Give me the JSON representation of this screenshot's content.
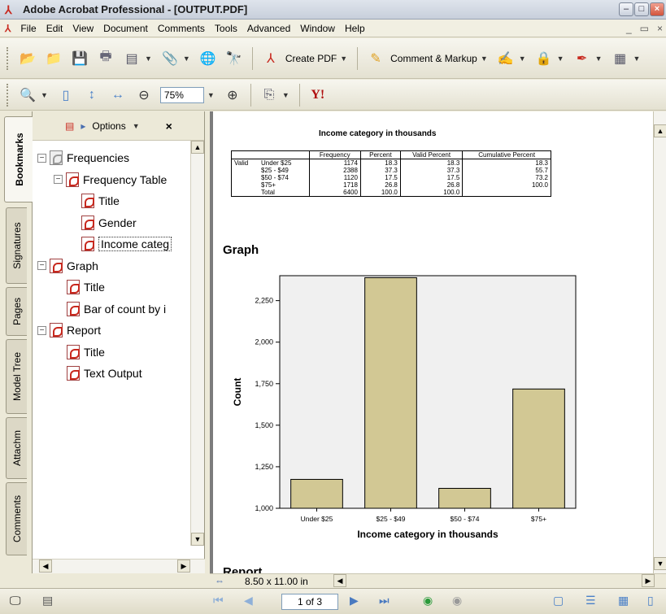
{
  "window": {
    "title": "Adobe Acrobat Professional - [OUTPUT.PDF]"
  },
  "menu": [
    "File",
    "Edit",
    "View",
    "Document",
    "Comments",
    "Tools",
    "Advanced",
    "Window",
    "Help"
  ],
  "toolbar": {
    "create_pdf": "Create PDF",
    "comment_markup": "Comment & Markup",
    "zoom": "75%"
  },
  "left_tabs": [
    "Bookmarks",
    "Signatures",
    "Pages",
    "Model Tree",
    "Attachm",
    "Comments"
  ],
  "bookmarks": {
    "options_label": "Options",
    "close": "×",
    "tree": [
      {
        "label": "Frequencies",
        "level": 0,
        "expand": "−",
        "folder": true
      },
      {
        "label": "Frequency Table",
        "level": 1,
        "expand": "−"
      },
      {
        "label": "Title",
        "level": 2
      },
      {
        "label": "Gender",
        "level": 2
      },
      {
        "label": "Income categ",
        "level": 2,
        "selected": true
      },
      {
        "label": "Graph",
        "level": 0,
        "expand": "−"
      },
      {
        "label": "Title",
        "level": 1
      },
      {
        "label": "Bar of count by i",
        "level": 1
      },
      {
        "label": "Report",
        "level": 0,
        "expand": "−"
      },
      {
        "label": "Title",
        "level": 1
      },
      {
        "label": "Text Output",
        "level": 1
      }
    ]
  },
  "document": {
    "table_title": "Income category in thousands",
    "table": {
      "headers": [
        "Frequency",
        "Percent",
        "Valid Percent",
        "Cumulative Percent"
      ],
      "group_label": "Valid",
      "rows": [
        [
          "Under $25",
          "1174",
          "18.3",
          "18.3",
          "18.3"
        ],
        [
          "$25 - $49",
          "2388",
          "37.3",
          "37.3",
          "55.7"
        ],
        [
          "$50 - $74",
          "1120",
          "17.5",
          "17.5",
          "73.2"
        ],
        [
          "$75+",
          "1718",
          "26.8",
          "26.8",
          "100.0"
        ],
        [
          "Total",
          "6400",
          "100.0",
          "100.0",
          ""
        ]
      ]
    },
    "graph_heading": "Graph",
    "bottom_partial": "Report"
  },
  "chart_data": {
    "type": "bar",
    "categories": [
      "Under $25",
      "$25 - $49",
      "$50 - $74",
      "$75+"
    ],
    "values": [
      1174,
      2388,
      1120,
      1718
    ],
    "xlabel": "Income category in thousands",
    "ylabel": "Count",
    "ylim": [
      1000,
      2400
    ],
    "yticks": [
      1000,
      1250,
      1500,
      1750,
      2000,
      2250
    ],
    "ytick_labels": [
      "1,000",
      "1,250",
      "1,500",
      "1,750",
      "2,000",
      "2,250"
    ],
    "bar_color": "#d2c894",
    "plot_bg": "#f0f0f0"
  },
  "status": {
    "page_size": "8.50 x 11.00 in",
    "page_field": "1 of 3"
  }
}
